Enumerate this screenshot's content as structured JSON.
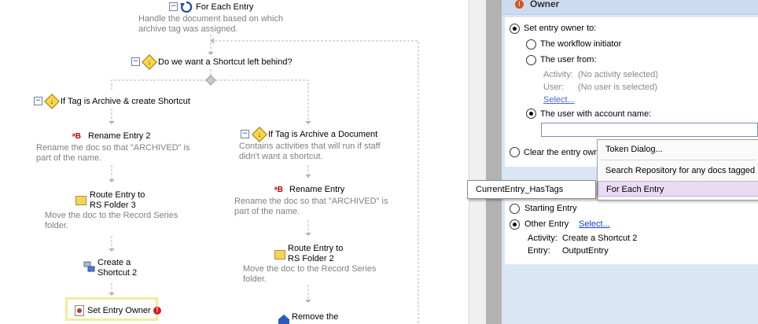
{
  "workflow": {
    "for_each": {
      "title": "For Each Entry",
      "desc_line1": "Handle the document based on which",
      "desc_line2": "archive tag was assigned."
    },
    "shortcut_question": {
      "title": "Do we want a Shortcut left behind?"
    },
    "branch_left": {
      "title": "If Tag is Archive & create Shortcut"
    },
    "rename2": {
      "title": "Rename Entry 2",
      "desc_line1": "Rename the doc so that \"ARCHIVED\" is",
      "desc_line2": "part of the name."
    },
    "route3": {
      "title_line1": "Route Entry to",
      "title_line2": "RS Folder 3",
      "desc_line1": "Move the doc to the Record Series",
      "desc_line2": "folder."
    },
    "shortcut2": {
      "title_line1": "Create a",
      "title_line2": "Shortcut 2"
    },
    "set_owner": {
      "title": "Set Entry Owner"
    },
    "branch_right": {
      "title": "If Tag is Archive a Document",
      "desc_line1": "Contains activities that will run if staff",
      "desc_line2": "didn't want a shortcut."
    },
    "rename": {
      "title": "Rename Entry",
      "desc_line1": "Rename the doc so that \"ARCHIVED\" is",
      "desc_line2": "part of the name."
    },
    "route2": {
      "title_line1": "Route Entry to",
      "title_line2": "RS Folder 2",
      "desc_line1": "Move the doc to the Record Series",
      "desc_line2": "folder."
    },
    "remove": {
      "title": "Remove the"
    }
  },
  "properties": {
    "section_title": "Owner",
    "set_owner_to": "Set entry owner to:",
    "opt_initiator": "The workflow initiator",
    "opt_user_from": "The user from:",
    "activity_label": "Activity:",
    "activity_value": "(No activity selected)",
    "user_label": "User:",
    "user_value": "(No user is selected)",
    "select_link": "Select...",
    "opt_account": "The user with account name:",
    "account_value": "",
    "clear_owner": "Clear the entry own",
    "starting_entry": "Starting Entry",
    "other_entry": "Other Entry",
    "other_select": "Select...",
    "activity2_label": "Activity:",
    "activity2_value": "Create a Shortcut 2",
    "entry_label": "Entry:",
    "entry_value": "OutputEntry"
  },
  "context_menu": {
    "items": [
      "Token Dialog...",
      "Search Repository for any docs tagged",
      "For Each Entry"
    ]
  },
  "tooltip": {
    "text": "CurrentEntry_HasTags"
  },
  "colors": {
    "accent_highlight": "#e9dcf2",
    "panel_bg": "#dbe6f5",
    "desc_text": "#808080",
    "link": "#1a3fbf"
  }
}
